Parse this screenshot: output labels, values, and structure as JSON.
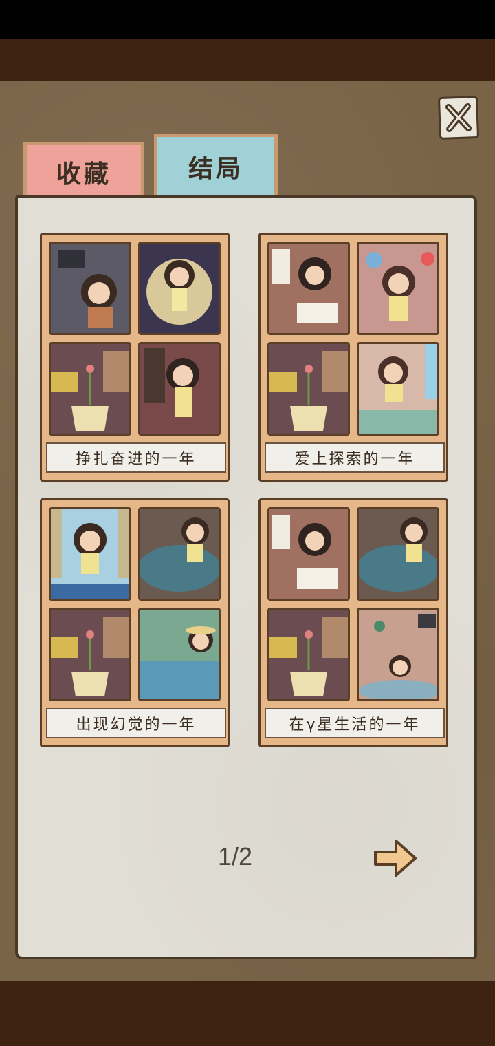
{
  "tabs": [
    {
      "label": "收藏",
      "active": false,
      "color": "#eea29a"
    },
    {
      "label": "结局",
      "active": true,
      "color": "#9fd1d6"
    }
  ],
  "close_icon": "close-icon",
  "endings": [
    {
      "title": "挣扎奋进的一年"
    },
    {
      "title": "爱上探索的一年"
    },
    {
      "title": "出现幻觉的一年"
    },
    {
      "title": "在γ星生活的一年"
    }
  ],
  "pagination": {
    "current": 1,
    "total": 2,
    "text": "1/2"
  },
  "next_icon": "arrow-right-icon",
  "colors": {
    "board": "#7a6448",
    "panel": "#e1ded6",
    "card": "#e6b788",
    "dark_band": "#3e2212"
  }
}
